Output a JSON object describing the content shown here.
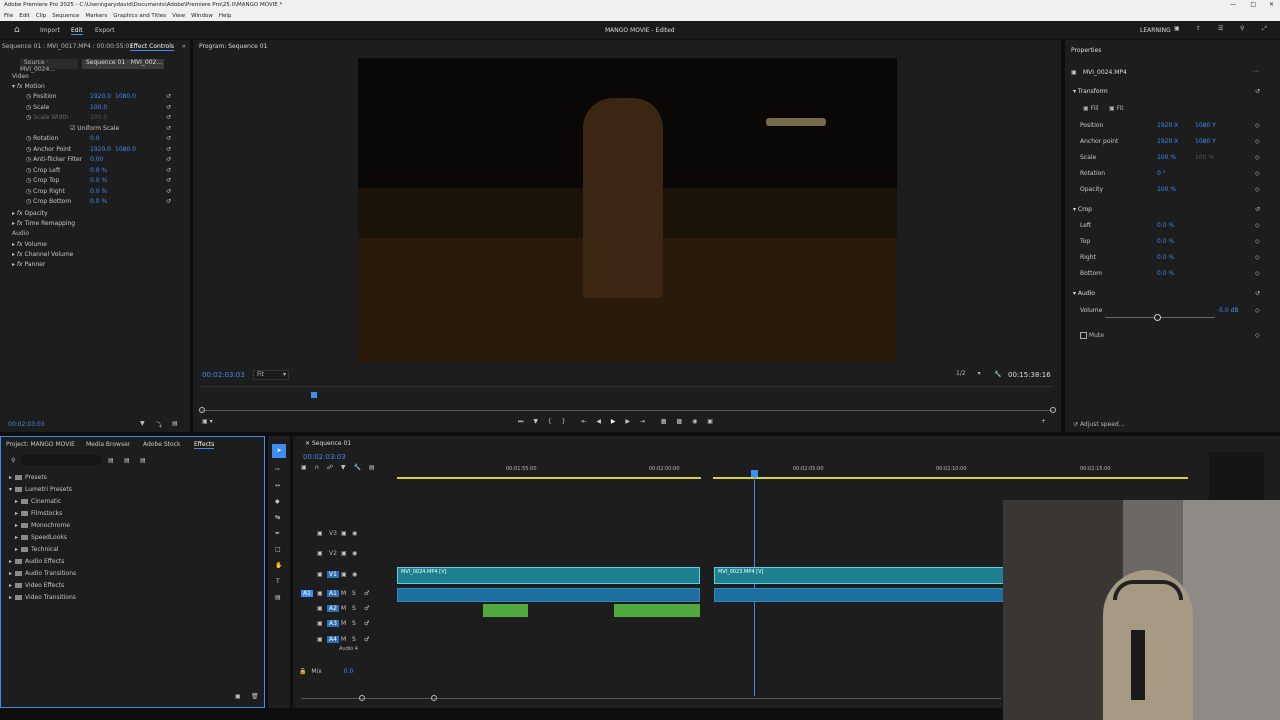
{
  "app": {
    "window_title": "Adobe Premiere Pro 2025 - C:\\Users\\garydavid\\Documents\\Adobe\\Premiere Pro\\25.0\\MANGO MOVIE *",
    "menus": [
      "File",
      "Edit",
      "Clip",
      "Sequence",
      "Markers",
      "Graphics and Titles",
      "View",
      "Window",
      "Help"
    ],
    "workspace_tabs": [
      "Import",
      "Edit",
      "Export"
    ],
    "active_workspace": "Edit",
    "project_title": "MANGO MOVIE - Edited",
    "learning_label": "LEARNING"
  },
  "effect_controls": {
    "header_left": "Sequence 01 : MVI_0017.MP4 : 00:00:55:01",
    "tab": "Effect Controls",
    "source_tab": "Source · MVI_0024...",
    "seq_tab": "Sequence 01 · MVI_002...",
    "section_video": "Video",
    "motion": "Motion",
    "rows": [
      {
        "label": "Position",
        "v1": "1920.0",
        "v2": "1080.0"
      },
      {
        "label": "Scale",
        "v1": "100.0",
        "v2": ""
      },
      {
        "label": "Scale Width",
        "v1": "100.0",
        "v2": ""
      },
      {
        "label": "Uniform Scale",
        "v1": "",
        "v2": ""
      },
      {
        "label": "Rotation",
        "v1": "0.0",
        "v2": ""
      },
      {
        "label": "Anchor Point",
        "v1": "1920.0",
        "v2": "1080.0"
      },
      {
        "label": "Anti-flicker Filter",
        "v1": "0.00",
        "v2": ""
      },
      {
        "label": "Crop Left",
        "v1": "0.0 %",
        "v2": ""
      },
      {
        "label": "Crop Top",
        "v1": "0.0 %",
        "v2": ""
      },
      {
        "label": "Crop Right",
        "v1": "0.0 %",
        "v2": ""
      },
      {
        "label": "Crop Bottom",
        "v1": "0.0 %",
        "v2": ""
      }
    ],
    "opacity": "Opacity",
    "time_remapping": "Time Remapping",
    "section_audio": "Audio",
    "volume": "Volume",
    "channel_volume": "Channel Volume",
    "panner": "Panner",
    "timecode": "00:02:03:03"
  },
  "program": {
    "tab": "Program: Sequence 01",
    "timecode": "00:02:03:03",
    "fit": "Fit",
    "resolution": "1/2",
    "duration": "00:15:38:16"
  },
  "properties": {
    "title": "Properties",
    "clip": "MVI_0024.MP4",
    "transform": "Transform",
    "fill": "Fill",
    "fit": "Fit",
    "rows": [
      {
        "label": "Position",
        "v1": "1920 X",
        "v2": "1080 Y"
      },
      {
        "label": "Anchor point",
        "v1": "1920 X",
        "v2": "1080 Y"
      },
      {
        "label": "Scale",
        "v1": "100 %",
        "v2": "100 %"
      },
      {
        "label": "Rotation",
        "v1": "0 °",
        "v2": ""
      },
      {
        "label": "Opacity",
        "v1": "100 %",
        "v2": ""
      }
    ],
    "crop": "Crop",
    "crop_rows": [
      {
        "label": "Left",
        "v1": "0.0 %"
      },
      {
        "label": "Top",
        "v1": "0.0 %"
      },
      {
        "label": "Right",
        "v1": "0.0 %"
      },
      {
        "label": "Bottom",
        "v1": "0.0 %"
      }
    ],
    "audio": "Audio",
    "volume": "Volume",
    "volume_value": "-5.0 dB",
    "mute": "Mute",
    "adjust_speed": "Adjust speed..."
  },
  "project_panel": {
    "tabs": [
      "Project: MANGO MOVIE",
      "Media Browser",
      "Adobe Stock",
      "Effects"
    ],
    "active_tab": "Effects",
    "tree": [
      {
        "label": "Presets",
        "indent": 0,
        "open": false
      },
      {
        "label": "Lumetri Presets",
        "indent": 0,
        "open": true
      },
      {
        "label": "Cinematic",
        "indent": 1,
        "open": false
      },
      {
        "label": "Filmstocks",
        "indent": 1,
        "open": false
      },
      {
        "label": "Monochrome",
        "indent": 1,
        "open": false
      },
      {
        "label": "SpeedLooks",
        "indent": 1,
        "open": false
      },
      {
        "label": "Technical",
        "indent": 1,
        "open": false
      },
      {
        "label": "Audio Effects",
        "indent": 0,
        "open": false
      },
      {
        "label": "Audio Transitions",
        "indent": 0,
        "open": false
      },
      {
        "label": "Video Effects",
        "indent": 0,
        "open": false
      },
      {
        "label": "Video Transitions",
        "indent": 0,
        "open": false
      }
    ]
  },
  "timeline": {
    "tab": "Sequence 01",
    "timecode": "00:02:03:03",
    "ruler": [
      "00:01:55:00",
      "00:02:00:00",
      "00:02:05:00",
      "00:02:10:00",
      "00:02:15:00"
    ],
    "tracks": [
      {
        "name": "V3",
        "kind": "video"
      },
      {
        "name": "V2",
        "kind": "video"
      },
      {
        "name": "V1",
        "kind": "video"
      },
      {
        "name": "A1",
        "kind": "audio"
      },
      {
        "name": "A2",
        "kind": "audio"
      },
      {
        "name": "A3",
        "kind": "audio"
      },
      {
        "name": "A4",
        "kind": "audio"
      }
    ],
    "audio4_label": "Audio 4",
    "mix_label": "Mix",
    "mix_value": "0.0",
    "clip1_label": "MVI_0024.MP4 [V]",
    "clip2_label": "MVI_0023.MP4 [V]"
  },
  "colors": {
    "accent": "#3e8cf0",
    "video_clip": "#1e7f91",
    "audio_clip": "#1e6fa0",
    "music_clip": "#4fa93d",
    "playhead": "#3e8cf0"
  }
}
